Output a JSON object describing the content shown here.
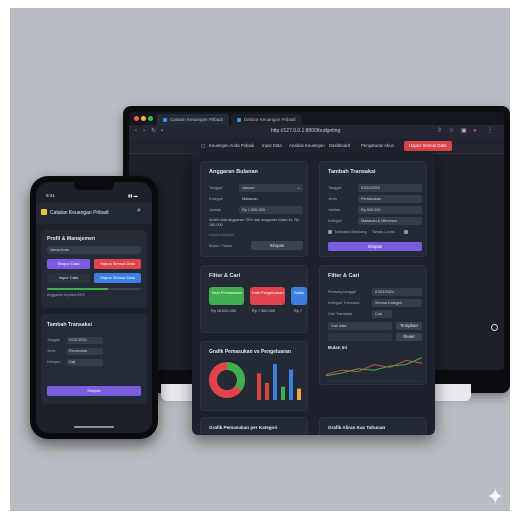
{
  "browser": {
    "tabs": [
      "Catatan Keuangan Pribadi",
      "Dasbor Keuangan Pribadi"
    ],
    "url": "http://127.0.0.1:8000/budgeting",
    "nav_links": [
      "Keuangan Anda Pribadi",
      "Input Data",
      "Analisis Keuangan",
      "Dashboard",
      "Pengaturan Akun"
    ],
    "reset_button": "Hapus Semua Data"
  },
  "anggaran": {
    "title": "Anggaran Bulanan",
    "fields": [
      {
        "label": "Tanggal",
        "value": "Januari"
      },
      {
        "label": "Kategori",
        "value": "Makanan"
      },
      {
        "label": "Jumlah",
        "value": "Rp 1.500.000"
      }
    ],
    "note": "Ambil data anggaran 75% dari anggaran bulan ini. Rp 150.000",
    "sub_label": "Kelola kategori",
    "filter_label": "Bulan / Tahun",
    "button": "Simpan"
  },
  "tambah": {
    "title": "Tambah Transaksi",
    "fields": [
      {
        "label": "Tanggal",
        "value": "01/01/2024"
      },
      {
        "label": "Jenis",
        "value": "Pemasukan"
      },
      {
        "label": "Jumlah",
        "value": "Rp 500.000"
      },
      {
        "label": "Kategori",
        "value": "Makanan & Minuman"
      }
    ],
    "check_a": "Transaksi Berulang",
    "check_b": "Tandai Lunas",
    "button": "Simpan"
  },
  "filter_left": {
    "title": "Filter & Cari",
    "stats": [
      {
        "label": "Total Pemasukan",
        "color": "#3fae4e",
        "sub": "Rp 15.000.000"
      },
      {
        "label": "Total Pengeluaran",
        "color": "#e0434a",
        "sub": "Rp 7.500.000"
      },
      {
        "label": "Saldo",
        "color": "#3d7fe0",
        "sub": "Rp 7"
      }
    ]
  },
  "filter_right": {
    "title": "Filter & Cari",
    "fields": [
      {
        "label": "Rentang tanggal",
        "value": "01/01/2024"
      },
      {
        "label": "Kategori Transaksi",
        "value": "Semua Kategori"
      },
      {
        "label": "Cari Transaksi",
        "value": "Cari"
      }
    ],
    "search_value": "Cari data",
    "apply_button": "Terapkan",
    "reset_button": "Reset",
    "month_label": "Bulan Ini"
  },
  "grafik": {
    "title": "Grafik Pemasukan vs Pengeluaran",
    "donut": [
      {
        "label": "Pemasukan",
        "value": 35,
        "color": "#3fae4e"
      },
      {
        "label": "Pengeluaran",
        "value": 65,
        "color": "#e0434a"
      }
    ],
    "bars": [
      {
        "value": 0.7,
        "color": "#e0434a"
      },
      {
        "value": 0.45,
        "color": "#e0434a"
      },
      {
        "value": 0.95,
        "color": "#3d7fe0"
      },
      {
        "value": 0.35,
        "color": "#3fae4e"
      },
      {
        "value": 0.8,
        "color": "#3d7fe0"
      },
      {
        "value": 0.3,
        "color": "#f2a33a"
      }
    ]
  },
  "lines": {
    "series_a": [
      0.2,
      0.35,
      0.3,
      0.55,
      0.45,
      0.7,
      0.6
    ],
    "series_b": [
      0.15,
      0.25,
      0.4,
      0.35,
      0.5,
      0.55,
      0.8
    ],
    "color_a": "#e0434a",
    "color_b": "#3fae4e"
  },
  "bottom_titles": [
    "Grafik Pemasukan per Kategori",
    "Grafik Aliran Kas Tahunan"
  ],
  "phone": {
    "time": "9:41",
    "title": "Catatan Keuangan Pribadi",
    "profil_title": "Profil & Manajemen",
    "name_value": "Nama Anda",
    "btn_export": "Ekspor Data",
    "btn_delete": "Hapus Semua Data",
    "btn_import": "Impor Data",
    "btn_delete2": "Hapus Semua Data",
    "progress_label": "Anggaran terpakai 65%",
    "progress": 0.65,
    "tambah_title": "Tambah Transaksi",
    "fields": [
      {
        "label": "Tanggal",
        "value": "01/01/2024"
      },
      {
        "label": "Jenis",
        "value": "Pemasukan"
      },
      {
        "label": "Kategori",
        "value": "Gaji"
      }
    ],
    "save_button": "Simpan"
  }
}
